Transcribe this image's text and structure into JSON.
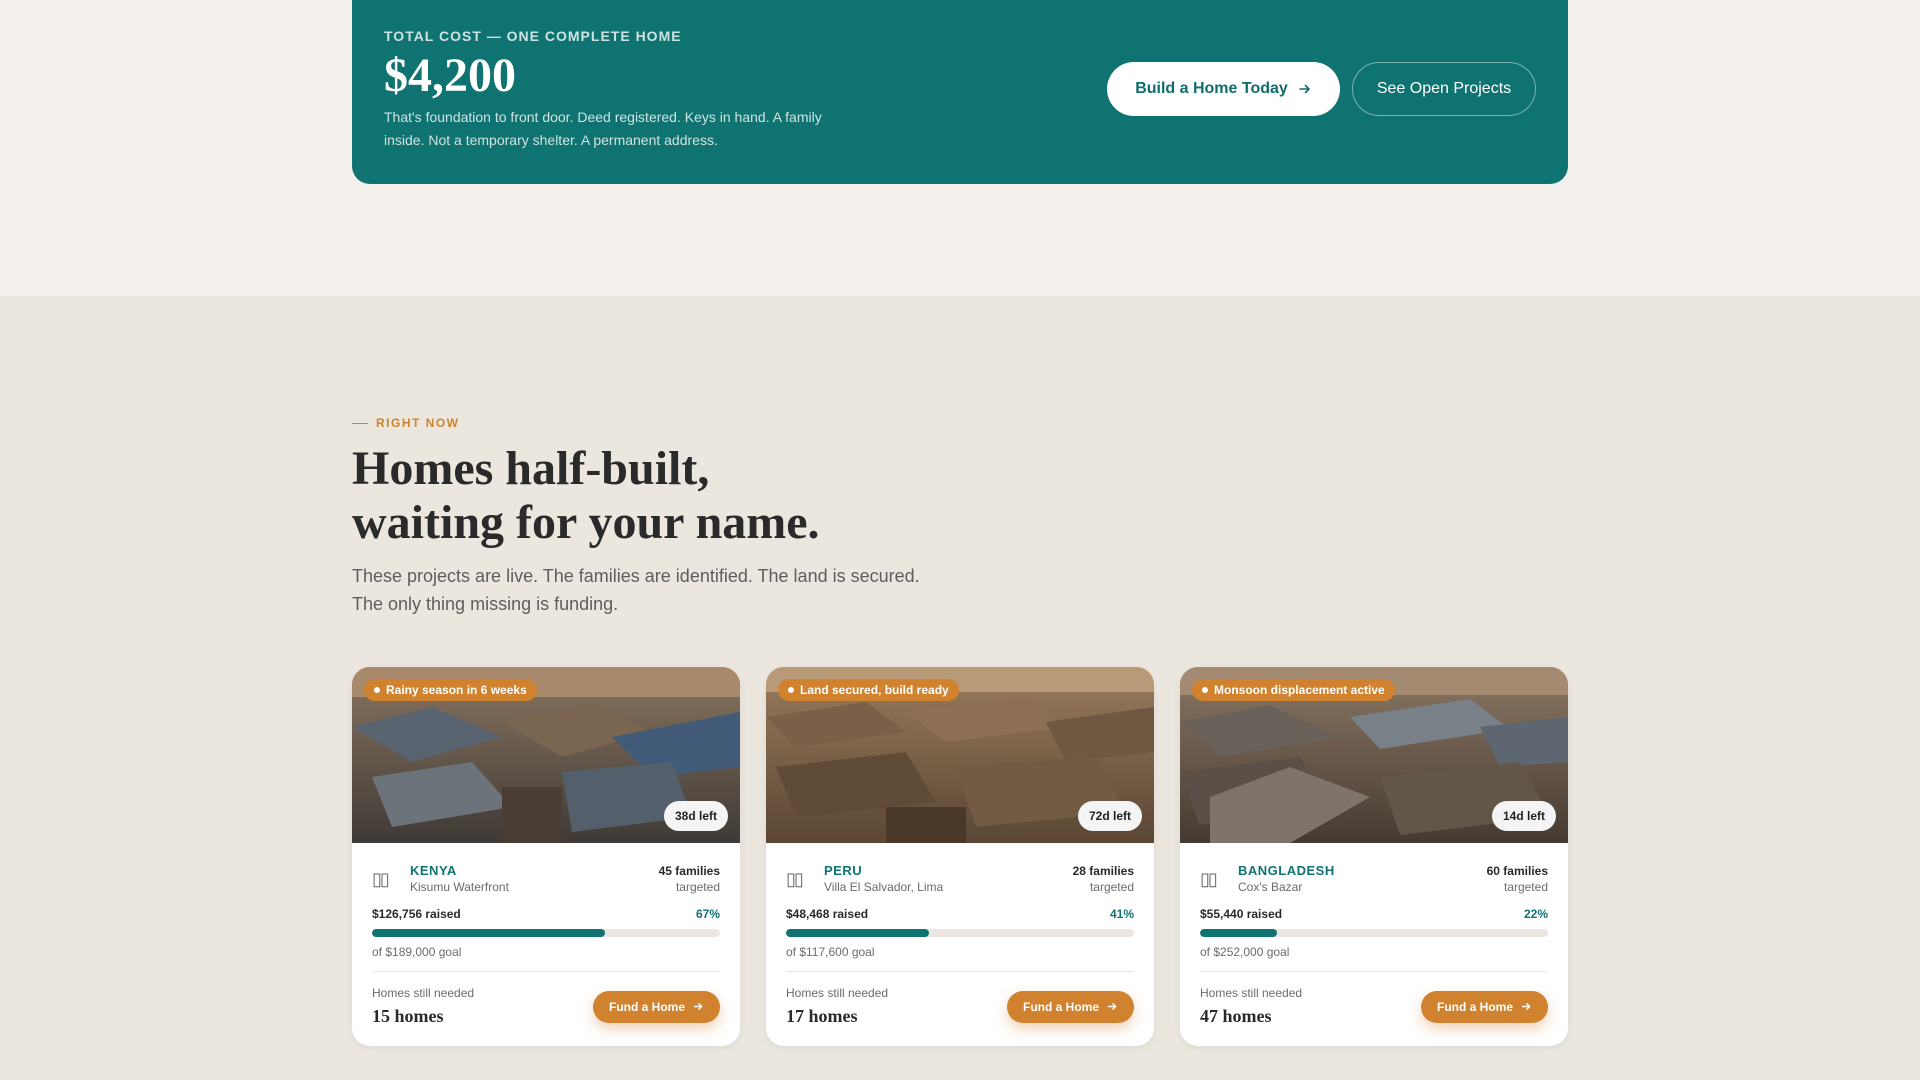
{
  "cta": {
    "eyebrow": "TOTAL COST — ONE COMPLETE HOME",
    "price": "$4,200",
    "description": "That's foundation to front door. Deed registered. Keys in hand. A family inside. Not a temporary shelter. A permanent address.",
    "primary_button": "Build a Home Today",
    "secondary_button": "See Open Projects"
  },
  "section": {
    "eyebrow": "RIGHT NOW",
    "headline_line1": "Homes half-built,",
    "headline_line2": "waiting for your name.",
    "subtext_line1": "These projects are live. The families are identified. The land is secured.",
    "subtext_line2": "The only thing missing is funding."
  },
  "projects": [
    {
      "badge": "Rainy season in 6 weeks",
      "days_left": "38d left",
      "flag": "▯▯",
      "country": "KENYA",
      "city": "Kisumu Waterfront",
      "families_count": "45 families",
      "families_label": "targeted",
      "raised": "$126,756 raised",
      "percent": "67%",
      "progress": 0.67,
      "goal": "of $189,000 goal",
      "needed_label": "Homes still needed",
      "needed": "15 homes",
      "button": "Fund a Home"
    },
    {
      "badge": "Land secured, build ready",
      "days_left": "72d left",
      "flag": "▯▯",
      "country": "PERU",
      "city": "Villa El Salvador, Lima",
      "families_count": "28 families",
      "families_label": "targeted",
      "raised": "$48,468 raised",
      "percent": "41%",
      "progress": 0.41,
      "goal": "of $117,600 goal",
      "needed_label": "Homes still needed",
      "needed": "17 homes",
      "button": "Fund a Home"
    },
    {
      "badge": "Monsoon displacement active",
      "days_left": "14d left",
      "flag": "▯▯",
      "country": "BANGLADESH",
      "city": "Cox's Bazar",
      "families_count": "60 families",
      "families_label": "targeted",
      "raised": "$55,440 raised",
      "percent": "22%",
      "progress": 0.22,
      "goal": "of $252,000 goal",
      "needed_label": "Homes still needed",
      "needed": "47 homes",
      "button": "Fund a Home"
    }
  ],
  "colors": {
    "teal": "#0f7372",
    "orange": "#d0822e",
    "page_bg": "#ebe6de",
    "top_bg": "#f3f0eb"
  }
}
